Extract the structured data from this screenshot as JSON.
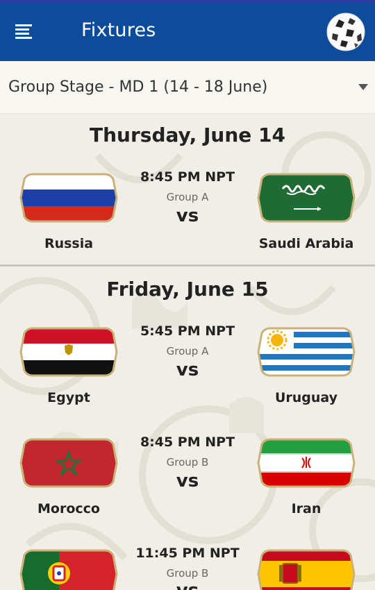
{
  "app_bar": {
    "title": "Fixtures",
    "menu_icon": "menu-icon",
    "logo_icon": "football-icon",
    "color": "#0d4c9b"
  },
  "stage_selector": {
    "selected": "Group Stage - MD 1 (14 - 18 June)",
    "arrow_icon": "dropdown-arrow-icon"
  },
  "days": [
    {
      "label": "Thursday, June 14",
      "matches": [
        {
          "time": "8:45 PM NPT",
          "group": "Group A",
          "vs": "vs",
          "home": "Russia",
          "away": "Saudi Arabia"
        }
      ]
    },
    {
      "label": "Friday, June 15",
      "matches": [
        {
          "time": "5:45 PM NPT",
          "group": "Group A",
          "vs": "vs",
          "home": "Egypt",
          "away": "Uruguay"
        },
        {
          "time": "8:45 PM NPT",
          "group": "Group B",
          "vs": "vs",
          "home": "Morocco",
          "away": "Iran"
        },
        {
          "time": "11:45 PM NPT",
          "group": "Group B",
          "vs": "vs",
          "home": "Portugal",
          "away": "Spain"
        }
      ]
    }
  ],
  "colors": {
    "russia": [
      "#ffffff",
      "#1c3fa8",
      "#d52b1e"
    ],
    "saudi_arabia": "#1f6b34",
    "egypt": [
      "#ce1126",
      "#ffffff",
      "#111111"
    ],
    "uruguay": [
      "#ffffff",
      "#1f76c2"
    ],
    "morocco": [
      "#c1272d",
      "#2d6b3a"
    ],
    "iran": [
      "#239f40",
      "#ffffff",
      "#da0000"
    ],
    "portugal": [
      "#176b2e",
      "#d5232a"
    ],
    "spain": [
      "#c60b1e",
      "#ffc400"
    ]
  }
}
